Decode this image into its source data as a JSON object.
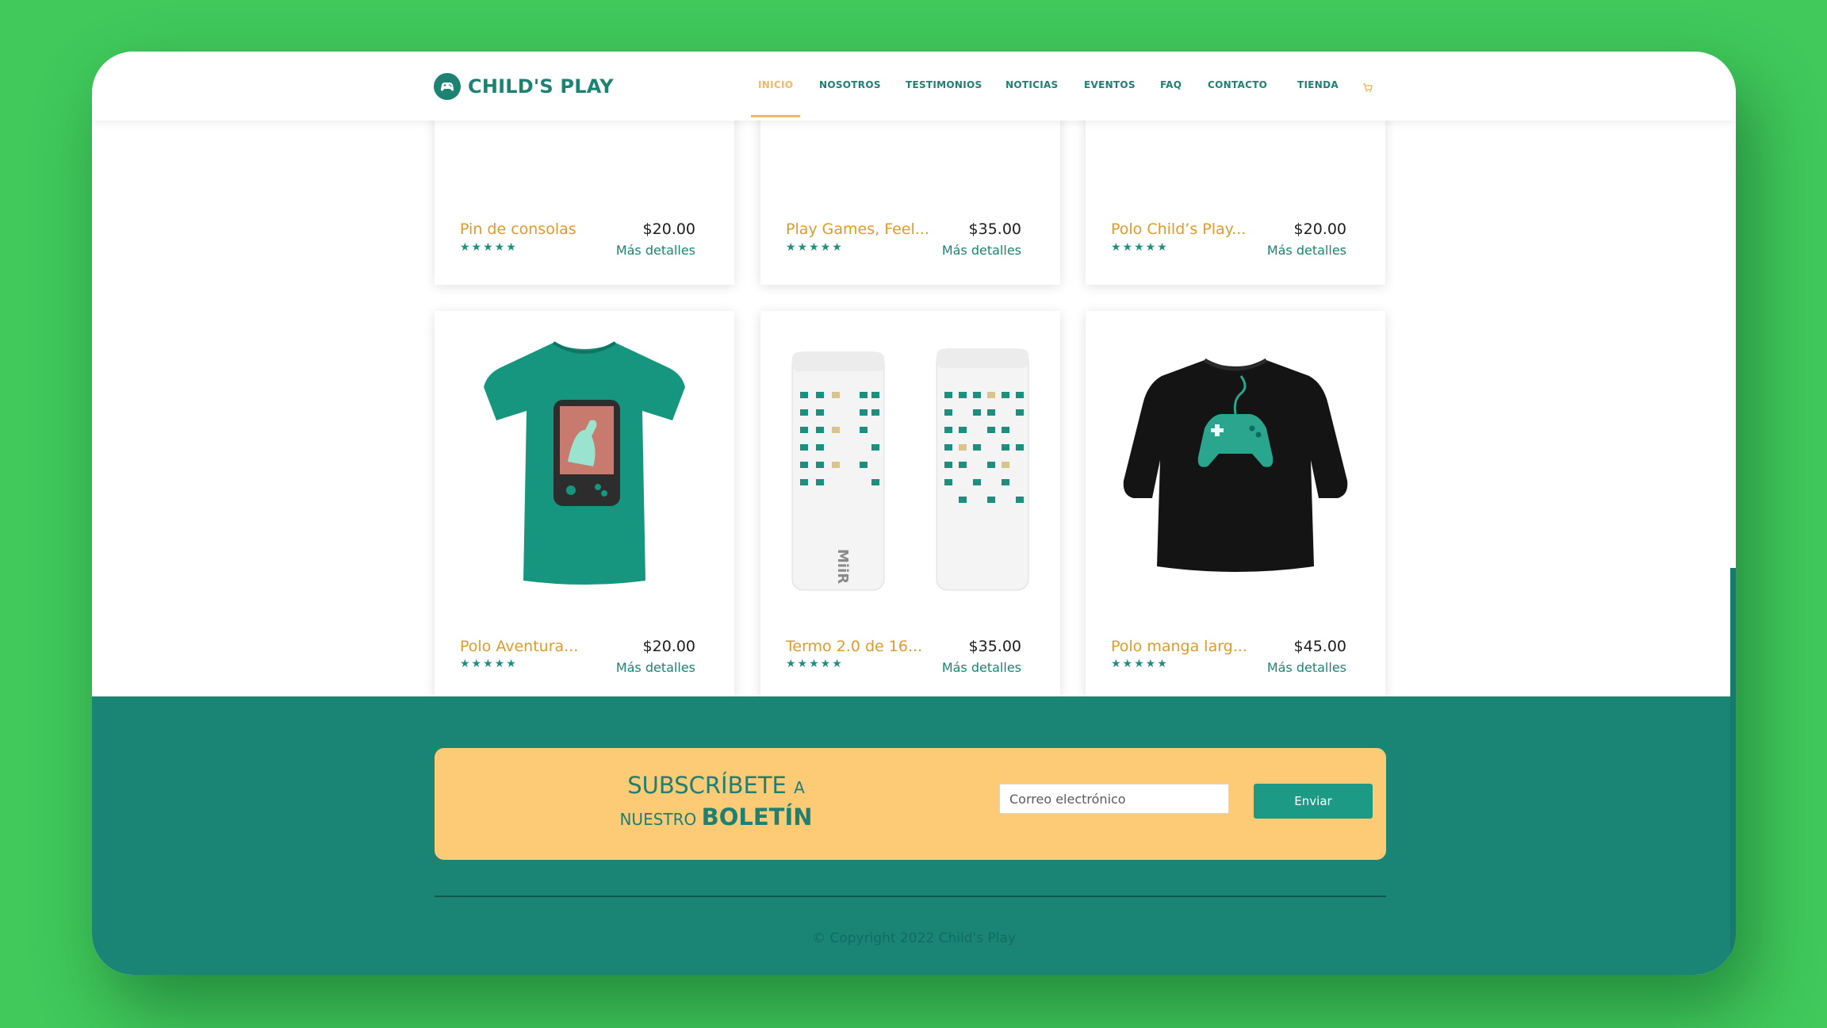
{
  "brand": {
    "name": "CHILD'S PLAY"
  },
  "colors": {
    "background": "#41c95c",
    "primary": "#1e8273",
    "accent": "#f3b766",
    "newsletter_bg": "#fdca75",
    "footer_bg": "#1a8575"
  },
  "nav": {
    "items": [
      {
        "label": "INICIO",
        "active": true
      },
      {
        "label": "NOSOTROS"
      },
      {
        "label": "TESTIMONIOS"
      },
      {
        "label": "NOTICIAS"
      },
      {
        "label": "EVENTOS"
      },
      {
        "label": "FAQ"
      },
      {
        "label": "CONTACTO"
      },
      {
        "label": "TIENDA"
      }
    ],
    "cart_icon": "cart-icon"
  },
  "products": [
    {
      "name": "Pin de consolas",
      "price": "$20.00",
      "rating_stars": "★★★★★",
      "details": "Más detalles",
      "image": "none"
    },
    {
      "name": "Play Games, Feel...",
      "price": "$35.00",
      "rating_stars": "★★★★★",
      "details": "Más detalles",
      "image": "none"
    },
    {
      "name": "Polo Child’s Play...",
      "price": "$20.00",
      "rating_stars": "★★★★★",
      "details": "Más detalles",
      "image": "none"
    },
    {
      "name": "Polo Aventura...",
      "price": "$20.00",
      "rating_stars": "★★★★★",
      "details": "Más detalles",
      "image": "green-tshirt"
    },
    {
      "name": "Termo 2.0 de 16...",
      "price": "$35.00",
      "rating_stars": "★★★★★",
      "details": "Más detalles",
      "image": "white-tumblers",
      "tumbler_text": "MiiR"
    },
    {
      "name": "Polo manga larg...",
      "price": "$45.00",
      "rating_stars": "★★★★★",
      "details": "Más detalles",
      "image": "black-sweatshirt"
    }
  ],
  "newsletter": {
    "line1_big": "SUBSCRÍBETE",
    "line1_small": "A",
    "line2_small": "NUESTRO",
    "line2_big": "BOLETÍN",
    "email_placeholder": "Correo electrónico",
    "submit_label": "Enviar"
  },
  "footer": {
    "copyright": "© Copyright 2022 Child's Play"
  }
}
